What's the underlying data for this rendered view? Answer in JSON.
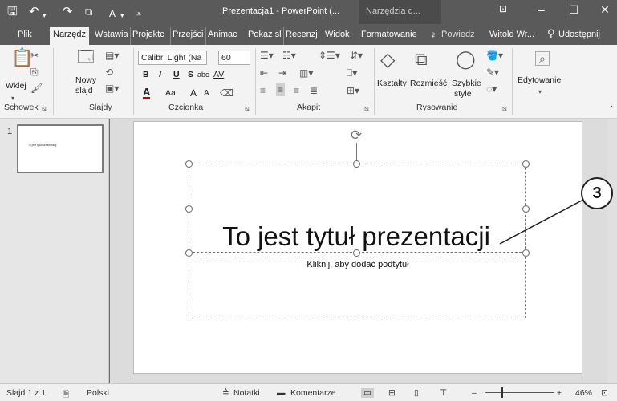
{
  "titlebar": {
    "save_icon": "save-icon",
    "undo_icon": "undo-icon",
    "redo_icon": "redo-icon",
    "start_icon": "presentation-start-icon",
    "font_color_glyph": "A",
    "doc_title": "Prezentacja1 - PowerPoint (...",
    "contextual_tab": "Narzędzia d...",
    "minimize": "–",
    "maximize": "☐",
    "close": "✕"
  },
  "tabs": [
    {
      "label": "Plik"
    },
    {
      "label": "Narzędz"
    },
    {
      "label": "Wstawia"
    },
    {
      "label": "Projektc"
    },
    {
      "label": "Przejści"
    },
    {
      "label": "Animac"
    },
    {
      "label": "Pokaz sl"
    },
    {
      "label": "Recenzj"
    },
    {
      "label": "Widok"
    },
    {
      "label": "Formatowanie"
    },
    {
      "label": "Powiedz"
    },
    {
      "label": "Witold Wr..."
    },
    {
      "label": "Udostępnij"
    }
  ],
  "ribbon": {
    "clipboard": {
      "paste": "Wklej",
      "group": "Schowek"
    },
    "slides": {
      "new_slide_1": "Nowy",
      "new_slide_2": "slajd",
      "group": "Slajdy"
    },
    "font": {
      "font_name": "Calibri Light (Na",
      "font_size": "60",
      "bold": "B",
      "italic": "I",
      "underline": "U",
      "shadow": "S",
      "strike": "abc",
      "spacing": "AV",
      "color": "A",
      "case": "Aa",
      "grow": "A",
      "shrink": "A",
      "group": "Czcionka"
    },
    "paragraph": {
      "group": "Akapit"
    },
    "drawing": {
      "shapes": "Kształty",
      "arrange": "Rozmieść",
      "styles_1": "Szybkie",
      "styles_2": "style",
      "group": "Rysowanie"
    },
    "editing": {
      "label": "Edytowanie"
    }
  },
  "slides_panel": {
    "number": "1",
    "thumb_text": "To jest tytuł prezentacji"
  },
  "slide": {
    "title": "To jest tytuł prezentacji",
    "subtitle_placeholder": "Kliknij, aby dodać podtytuł"
  },
  "callout": {
    "number": "3"
  },
  "statusbar": {
    "slide_info": "Slajd 1 z 1",
    "language": "Polski",
    "notes": "Notatki",
    "comments": "Komentarze",
    "zoom": "46%"
  }
}
